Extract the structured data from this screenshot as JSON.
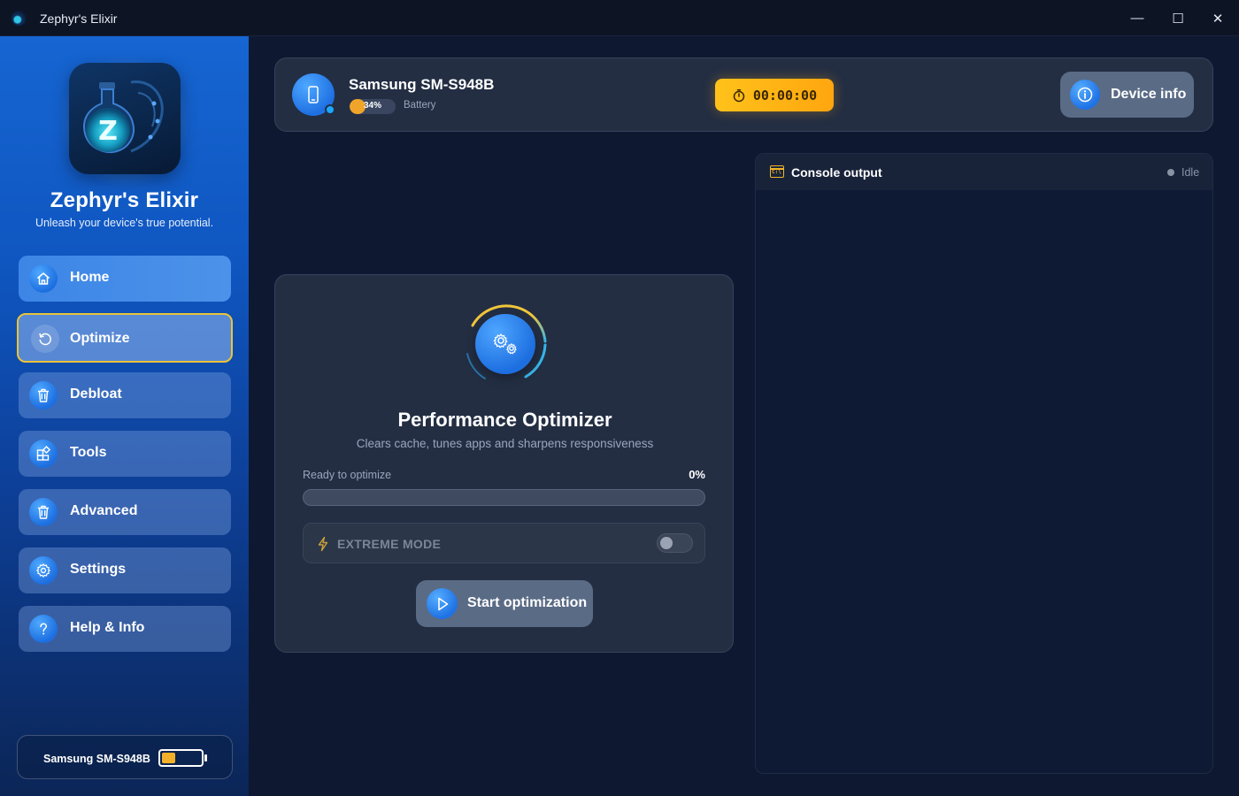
{
  "window": {
    "title": "Zephyr's Elixir",
    "controls": {
      "minimize": "—",
      "maximize": "☐",
      "close": "✕"
    }
  },
  "sidebar": {
    "brand_name": "Zephyr's Elixir",
    "tagline": "Unleash your device's true potential.",
    "items": [
      {
        "label": "Home",
        "icon": "home-icon"
      },
      {
        "label": "Optimize",
        "icon": "refresh-icon",
        "active": true
      },
      {
        "label": "Debloat",
        "icon": "trash-icon"
      },
      {
        "label": "Tools",
        "icon": "tools-icon"
      },
      {
        "label": "Advanced",
        "icon": "trash-icon"
      },
      {
        "label": "Settings",
        "icon": "gear-icon"
      },
      {
        "label": "Help & Info",
        "icon": "question-icon"
      }
    ],
    "device_card": {
      "name": "Samsung SM-S948B",
      "battery_level": 0.34
    }
  },
  "header": {
    "device_name": "Samsung SM-S948B",
    "battery_percent": "34%",
    "battery_level": 0.34,
    "battery_label": "Battery",
    "timer": "00:00:00",
    "device_info_label": "Device info"
  },
  "optimizer": {
    "title": "Performance Optimizer",
    "subtitle": "Clears cache, tunes apps and sharpens responsiveness",
    "progress_label": "Ready to optimize",
    "progress_percent": "0%",
    "progress_value": 0,
    "extreme_mode_label": "EXTREME MODE",
    "extreme_mode_on": false,
    "start_label": "Start optimization"
  },
  "console": {
    "title": "Console output",
    "status": "Idle"
  },
  "colors": {
    "accent": "#1d6fe0",
    "highlight": "#e9c43a",
    "timer": "#ffb31a",
    "battery": "#f4b028"
  }
}
